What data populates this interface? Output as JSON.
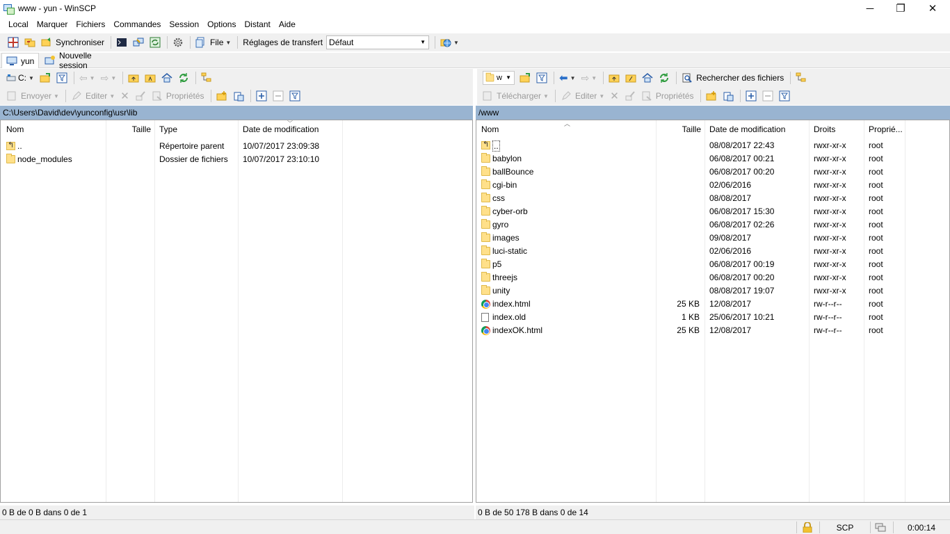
{
  "window": {
    "title": "www - yun - WinSCP"
  },
  "menu": [
    "Local",
    "Marquer",
    "Fichiers",
    "Commandes",
    "Session",
    "Options",
    "Distant",
    "Aide"
  ],
  "toolbar": {
    "sync_label": "Synchroniser",
    "file_label": "File",
    "transfer_label": "Réglages de transfert",
    "transfer_value": "Défaut"
  },
  "sessions": {
    "active": "yun",
    "new": "Nouvelle session"
  },
  "left": {
    "drive": "C:",
    "actions": {
      "upload": "Envoyer",
      "edit": "Editer",
      "props": "Propriétés"
    },
    "path": "C:\\Users\\David\\dev\\yunconfig\\usr\\lib",
    "columns": [
      "Nom",
      "Taille",
      "Type",
      "Date de modification"
    ],
    "rows": [
      {
        "icon": "parent-dir-icon",
        "name": "..",
        "size": "",
        "type": "Répertoire parent",
        "date": "10/07/2017  23:09:38"
      },
      {
        "icon": "folder-icon",
        "name": "node_modules",
        "size": "",
        "type": "Dossier de fichiers",
        "date": "10/07/2017  23:10:10"
      }
    ],
    "status": "0 B de 0 B dans 0 de 1"
  },
  "right": {
    "dir": "w",
    "find_label": "Rechercher des fichiers",
    "actions": {
      "download": "Télécharger",
      "edit": "Editer",
      "props": "Propriétés"
    },
    "path": "/www",
    "columns": [
      "Nom",
      "Taille",
      "Date de modification",
      "Droits",
      "Proprié..."
    ],
    "rows": [
      {
        "icon": "parent-dir-icon",
        "name": "..",
        "size": "",
        "date": "08/08/2017 22:43",
        "rights": "rwxr-xr-x",
        "owner": "root"
      },
      {
        "icon": "folder-icon",
        "name": "babylon",
        "size": "",
        "date": "06/08/2017 00:21",
        "rights": "rwxr-xr-x",
        "owner": "root"
      },
      {
        "icon": "folder-icon",
        "name": "ballBounce",
        "size": "",
        "date": "06/08/2017 00:20",
        "rights": "rwxr-xr-x",
        "owner": "root"
      },
      {
        "icon": "folder-icon",
        "name": "cgi-bin",
        "size": "",
        "date": "02/06/2016",
        "rights": "rwxr-xr-x",
        "owner": "root"
      },
      {
        "icon": "folder-icon",
        "name": "css",
        "size": "",
        "date": "08/08/2017",
        "rights": "rwxr-xr-x",
        "owner": "root"
      },
      {
        "icon": "folder-icon",
        "name": "cyber-orb",
        "size": "",
        "date": "06/08/2017 15:30",
        "rights": "rwxr-xr-x",
        "owner": "root"
      },
      {
        "icon": "folder-icon",
        "name": "gyro",
        "size": "",
        "date": "06/08/2017 02:26",
        "rights": "rwxr-xr-x",
        "owner": "root"
      },
      {
        "icon": "folder-icon",
        "name": "images",
        "size": "",
        "date": "09/08/2017",
        "rights": "rwxr-xr-x",
        "owner": "root"
      },
      {
        "icon": "folder-icon",
        "name": "luci-static",
        "size": "",
        "date": "02/06/2016",
        "rights": "rwxr-xr-x",
        "owner": "root"
      },
      {
        "icon": "folder-icon",
        "name": "p5",
        "size": "",
        "date": "06/08/2017 00:19",
        "rights": "rwxr-xr-x",
        "owner": "root"
      },
      {
        "icon": "folder-icon",
        "name": "threejs",
        "size": "",
        "date": "06/08/2017 00:20",
        "rights": "rwxr-xr-x",
        "owner": "root"
      },
      {
        "icon": "folder-icon",
        "name": "unity",
        "size": "",
        "date": "08/08/2017 19:07",
        "rights": "rwxr-xr-x",
        "owner": "root"
      },
      {
        "icon": "chrome-html-icon",
        "name": "index.html",
        "size": "25 KB",
        "date": "12/08/2017",
        "rights": "rw-r--r--",
        "owner": "root"
      },
      {
        "icon": "file-icon",
        "name": "index.old",
        "size": "1 KB",
        "date": "25/06/2017 10:21",
        "rights": "rw-r--r--",
        "owner": "root"
      },
      {
        "icon": "chrome-html-icon",
        "name": "indexOK.html",
        "size": "25 KB",
        "date": "12/08/2017",
        "rights": "rw-r--r--",
        "owner": "root"
      }
    ],
    "status": "0 B de 50 178 B dans 0 de 14"
  },
  "bottom": {
    "protocol": "SCP",
    "time": "0:00:14"
  },
  "colors": {
    "path_bar": "#99b4d1",
    "toolbar_bg": "#f0f0f0",
    "folder": "#ffe08a"
  }
}
